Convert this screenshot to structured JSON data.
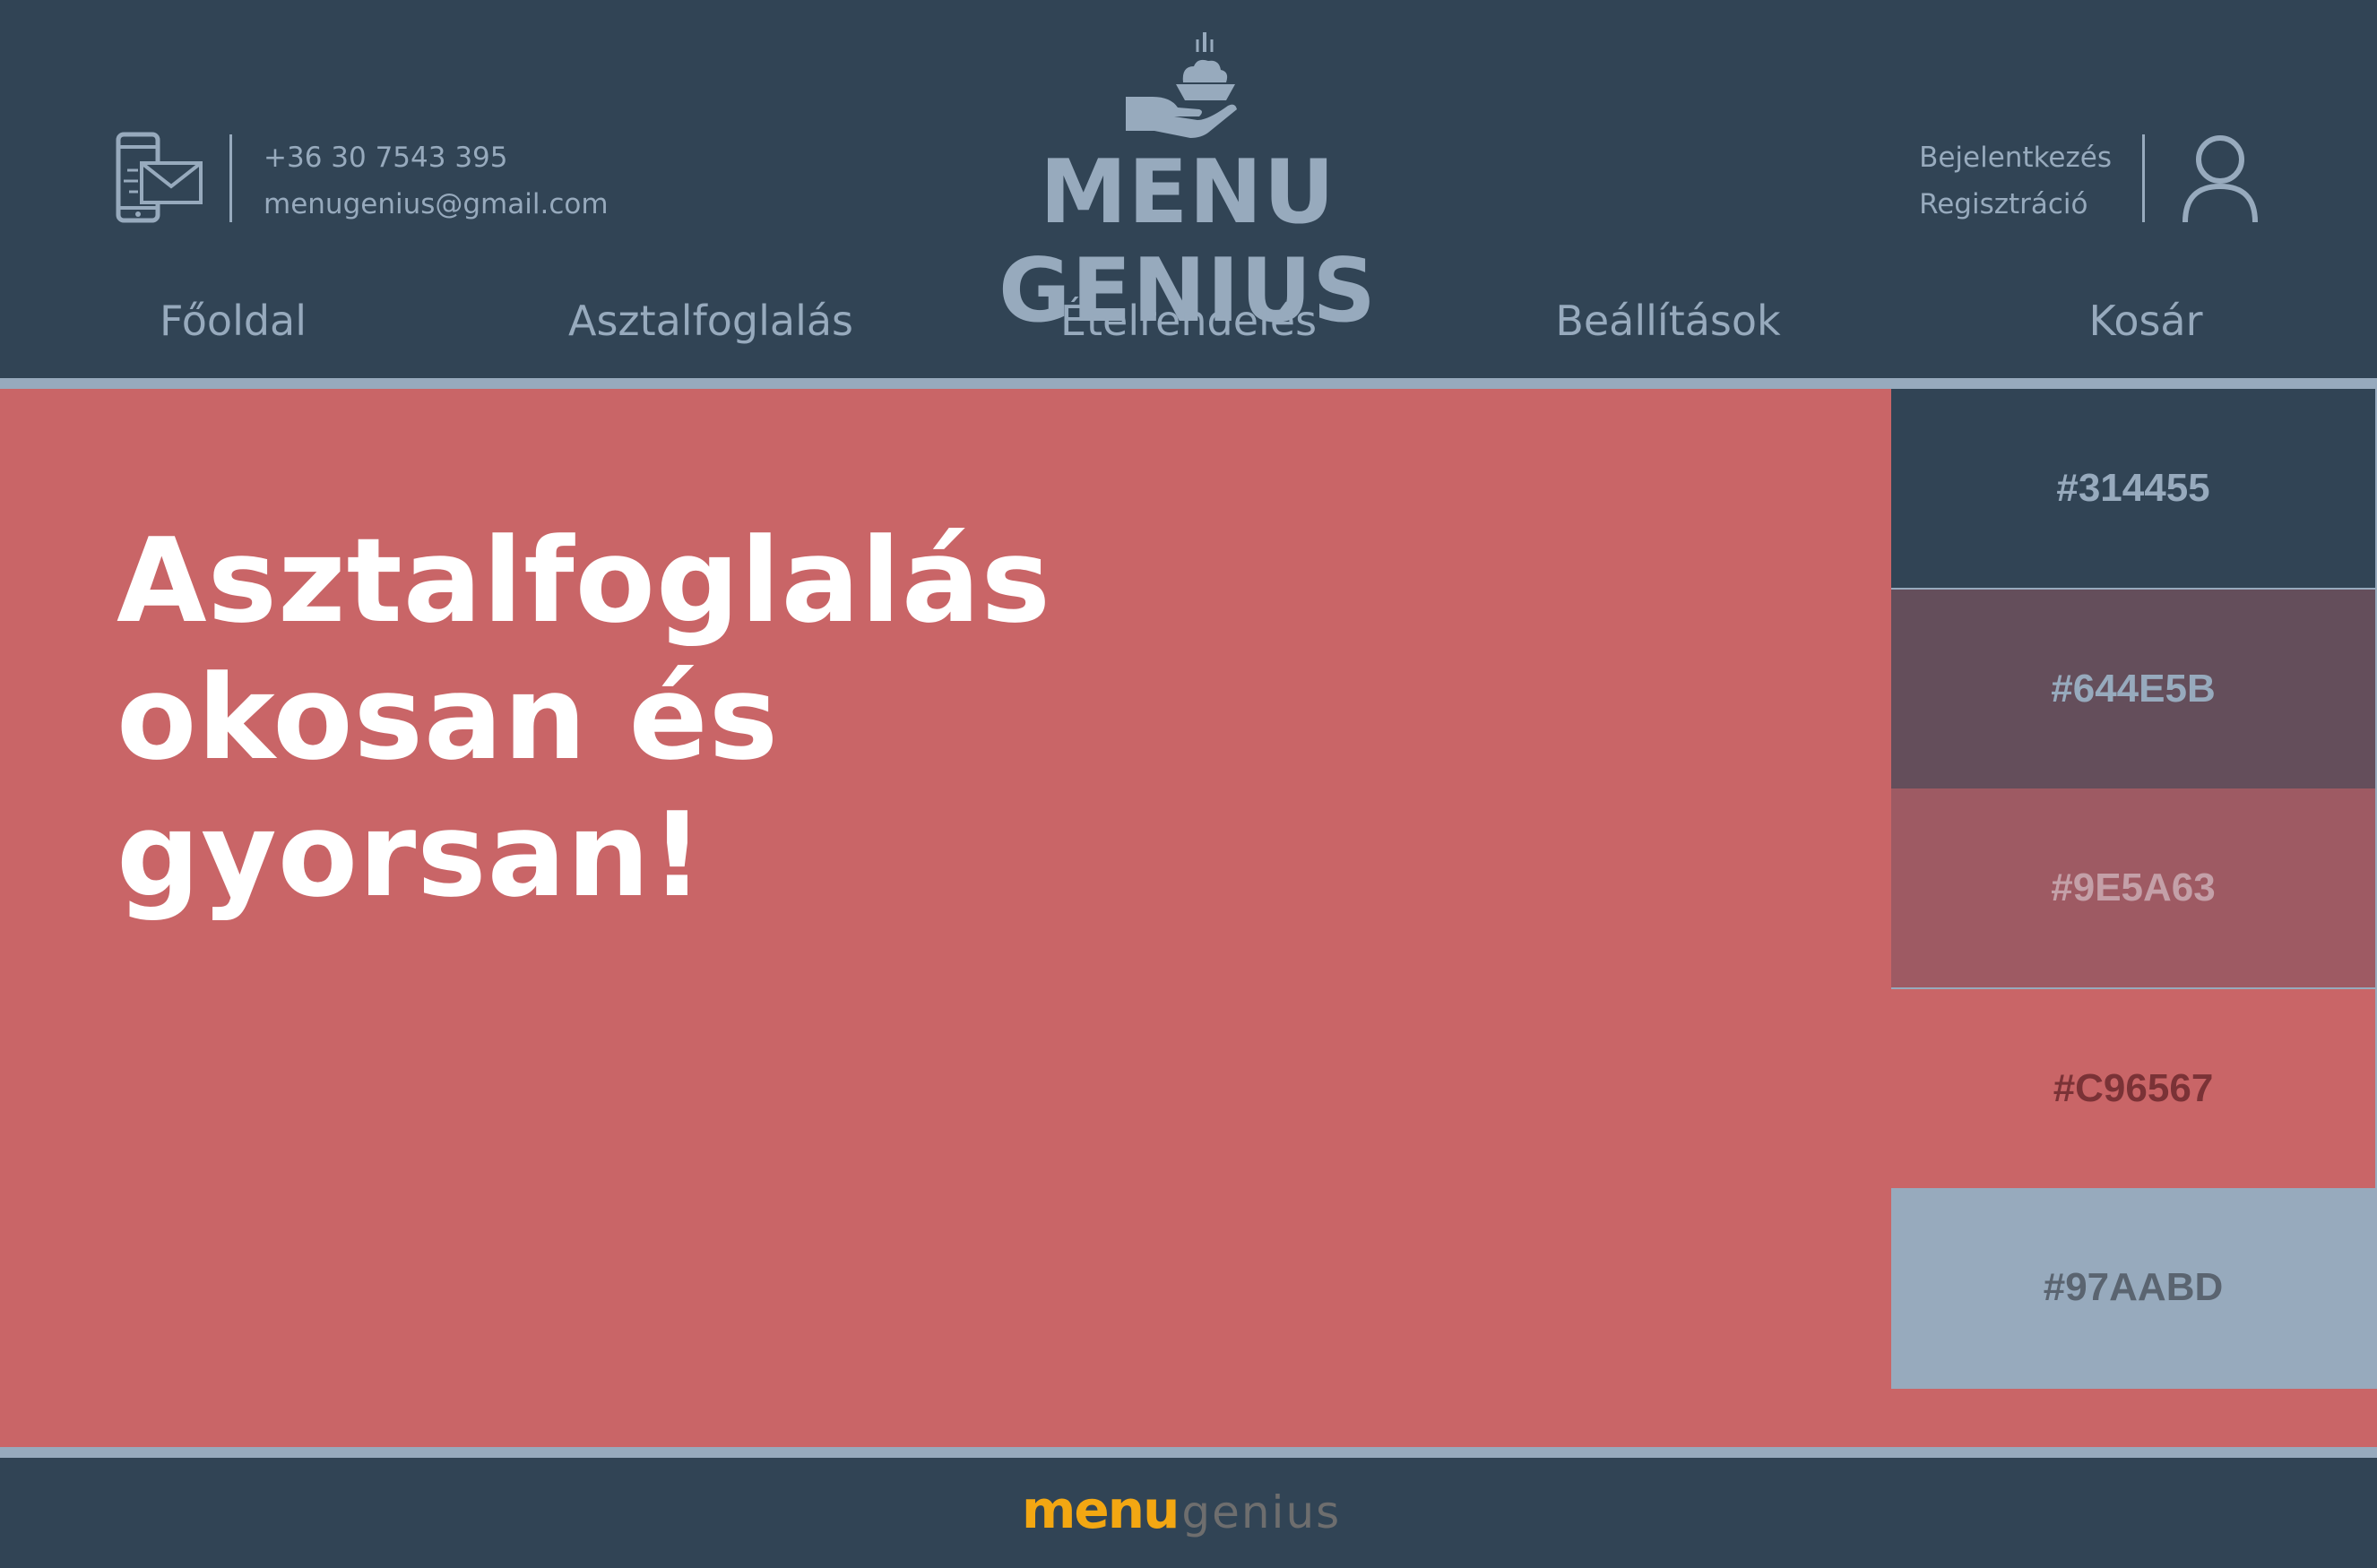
{
  "header": {
    "phone": "+36 30 7543 395",
    "email": "menugenius@gmail.com",
    "logo_word1": "Menu",
    "logo_word2": "Genius",
    "login": "Bejelentkezés",
    "register": "Regisztráció"
  },
  "nav": {
    "items": [
      {
        "label": "Főoldal"
      },
      {
        "label": "Asztalfoglalás"
      },
      {
        "label": "Ételrendelés"
      },
      {
        "label": "Beállítások"
      },
      {
        "label": "Kosár"
      }
    ]
  },
  "hero": {
    "line1": "Asztalfoglalás",
    "line2": "okosan és",
    "line3": "gyorsan!"
  },
  "palette": {
    "swatches": [
      {
        "label": "#314455",
        "color": "#314455",
        "text_color": "#97AABD"
      },
      {
        "label": "#644E5B",
        "color": "#644E5B",
        "text_color": "#97AABD"
      },
      {
        "label": "#9E5A63",
        "color": "#9E5A63",
        "text_color": "#C4A0A8"
      },
      {
        "label": "#C96567",
        "color": "#C96567",
        "text_color": "#7A3236"
      },
      {
        "label": "#97AABD",
        "color": "#97AABD",
        "text_color": "#5A6470"
      }
    ]
  },
  "footer": {
    "logo_menu": "menu",
    "logo_genius": "genius"
  },
  "colors": {
    "primary": "#314455",
    "secondary": "#644E5B",
    "tertiary": "#9E5A63",
    "accent": "#C96567",
    "light": "#97AABD",
    "footer_logo_orange": "#F3A712"
  },
  "icons": [
    "phone-mail-icon",
    "serving-hand-icon",
    "user-icon"
  ]
}
